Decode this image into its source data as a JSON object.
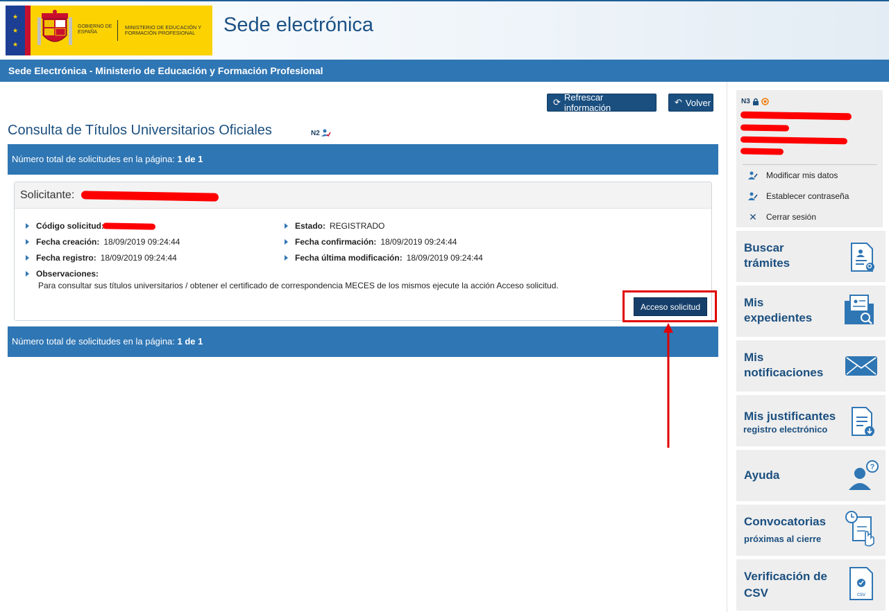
{
  "header": {
    "logo_gob": "GOBIERNO DE ESPAÑA",
    "logo_min": "MINISTERIO DE EDUCACIÓN Y FORMACIÓN PROFESIONAL",
    "site_title": "Sede electrónica"
  },
  "bluebar": {
    "title": "Sede Electrónica - Ministerio de Educación y Formación Profesional"
  },
  "toolbar": {
    "refresh_label": "Refrescar información",
    "back_label": "Volver"
  },
  "page": {
    "title": "Consulta de Títulos Universitarios Oficiales",
    "badge": "N2"
  },
  "summary": {
    "prefix": "Número total de solicitudes en la página:",
    "value": "1 de 1"
  },
  "card": {
    "applicant_label": "Solicitante:",
    "fields": {
      "codigo_label": "Código solicitud:",
      "estado_label": "Estado:",
      "estado_value": "REGISTRADO",
      "creacion_label": "Fecha creación:",
      "creacion_value": "18/09/2019 09:24:44",
      "confirmacion_label": "Fecha confirmación:",
      "confirmacion_value": "18/09/2019 09:24:44",
      "registro_label": "Fecha registro:",
      "registro_value": "18/09/2019 09:24:44",
      "ultima_label": "Fecha última modificación:",
      "ultima_value": "18/09/2019 09:24:44",
      "obs_label": "Observaciones:",
      "obs_text": "Para consultar sus títulos universitarios / obtener el certificado de correspondencia MECES de los mismos ejecute la acción Acceso solicitud."
    },
    "access_label": "Acceso solicitud"
  },
  "sidebar": {
    "level_badge": "N3",
    "links": [
      "Modificar mis datos",
      "Establecer contraseña",
      "Cerrar sesión"
    ],
    "tiles": [
      {
        "line1": "Buscar",
        "line2": "trámites"
      },
      {
        "line1": "Mis",
        "line2": "expedientes"
      },
      {
        "line1": "Mis",
        "line2": "notificaciones"
      },
      {
        "line1": "Mis justificantes",
        "sub": "registro electrónico"
      },
      {
        "line1": "Ayuda"
      },
      {
        "line1": "Convocatorias",
        "sub": "próximas al cierre"
      },
      {
        "line1": "Verificación de",
        "line2": "CSV"
      }
    ]
  },
  "colors": {
    "brand_blue": "#2f76b4",
    "dark_blue": "#1a4f80",
    "highlight_red": "#e00000",
    "logo_yellow": "#fcd200"
  }
}
